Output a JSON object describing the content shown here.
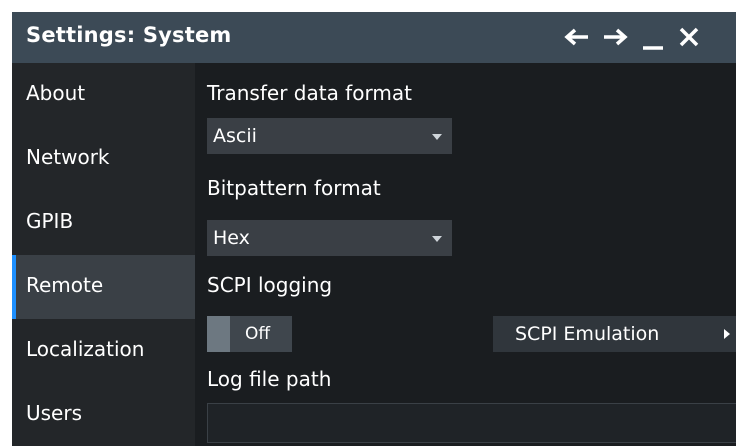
{
  "window": {
    "title": "Settings: System",
    "controls": {
      "back": "back-arrow-icon",
      "forward": "forward-arrow-icon",
      "minimize": "minimize-icon",
      "close": "close-icon"
    }
  },
  "sidebar": {
    "items": [
      {
        "label": "About"
      },
      {
        "label": "Network"
      },
      {
        "label": "GPIB"
      },
      {
        "label": "Remote",
        "selected": true
      },
      {
        "label": "Localization"
      },
      {
        "label": "Users"
      }
    ]
  },
  "content": {
    "transfer_format": {
      "label": "Transfer data format",
      "value": "Ascii"
    },
    "bitpattern_format": {
      "label": "Bitpattern format",
      "value": "Hex"
    },
    "scpi_logging": {
      "label": "SCPI logging",
      "state": "Off"
    },
    "scpi_emulation": {
      "label": "SCPI Emulation"
    },
    "log_file_path": {
      "label": "Log file path",
      "value": ""
    }
  },
  "colors": {
    "titlebar": "#3c4a56",
    "sidebar": "#232629",
    "sidebar_active": "#3a4046",
    "accent": "#1e90ff",
    "content": "#1a1d20",
    "control": "#3a3f45"
  }
}
